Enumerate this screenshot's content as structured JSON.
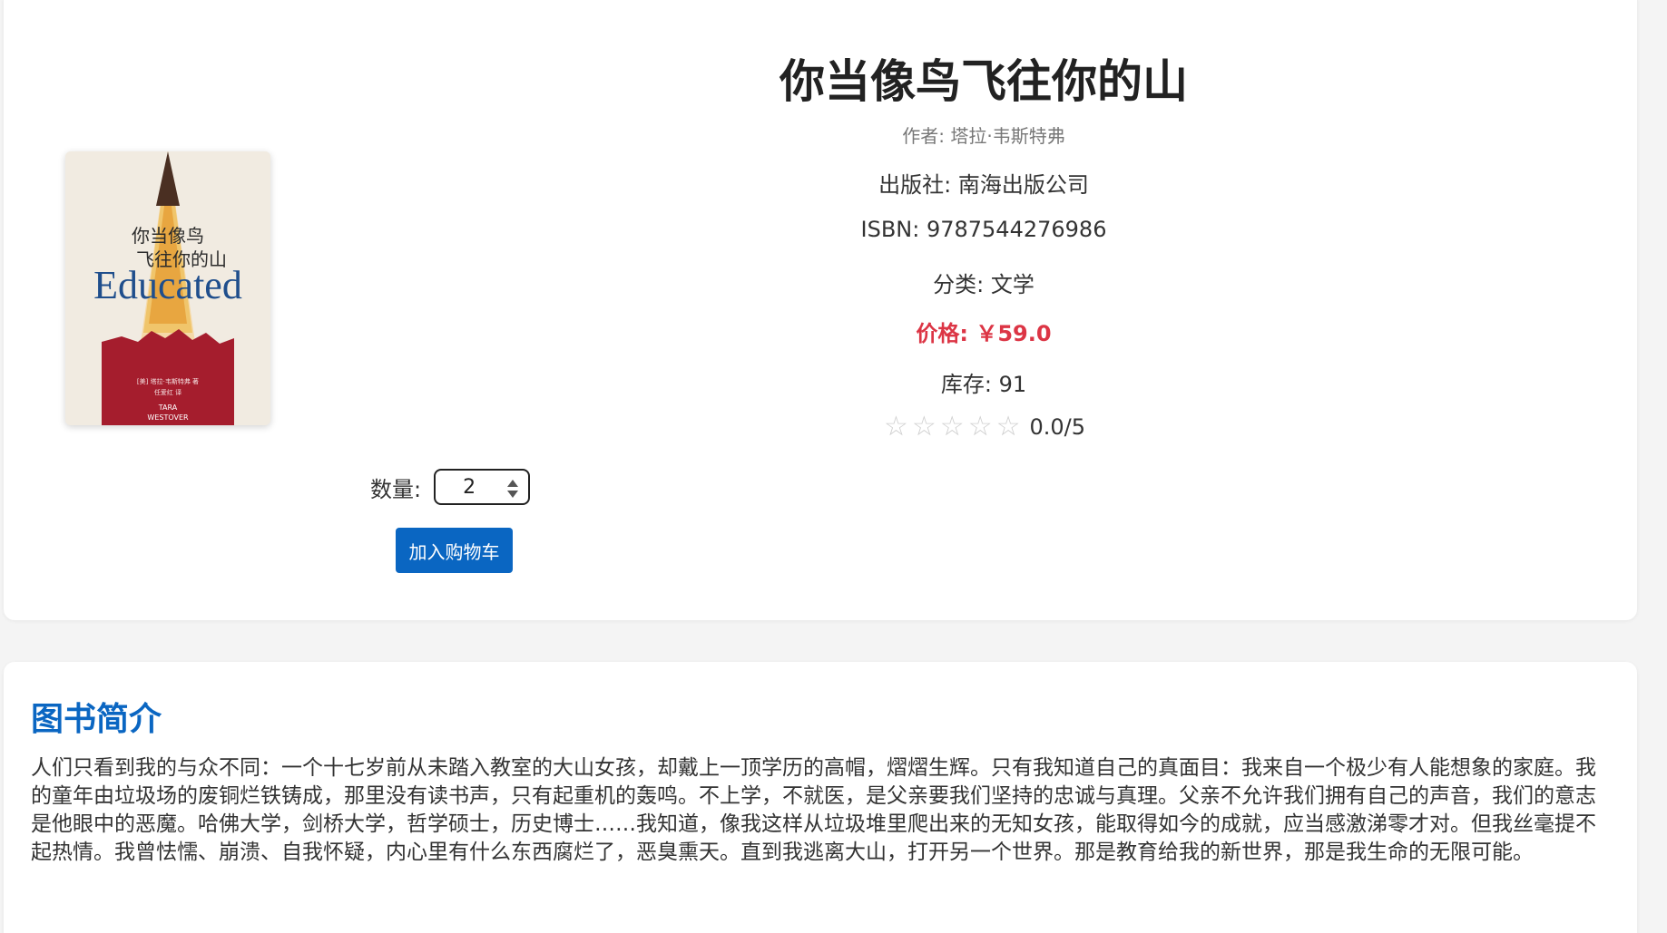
{
  "book": {
    "title": "你当像鸟飞往你的山",
    "author": "作者: 塔拉·韦斯特弗",
    "publisher": "出版社: 南海出版公司",
    "isbn": "ISBN: 9787544276986",
    "category": "分类: 文学",
    "price": "价格: ￥59.0",
    "stock": "库存: 91",
    "rating_text": "0.0/5",
    "rating_value": 0,
    "rating_max": 5,
    "star_glyph": "☆"
  },
  "cover": {
    "cn_line1": "你当像鸟",
    "cn_line2": "飞往你的山",
    "en_title": "Educated",
    "small_line1": "[美] 塔拉·韦斯特弗 著",
    "small_line2": "任爱红 译",
    "author_en1": "TARA",
    "author_en2": "WESTOVER"
  },
  "purchase": {
    "qty_label": "数量:",
    "qty_value": "2",
    "add_to_cart": "加入购物车"
  },
  "intro": {
    "heading": "图书简介",
    "text": "人们只看到我的与众不同：一个十七岁前从未踏入教室的大山女孩，却戴上一顶学历的高帽，熠熠生辉。只有我知道自己的真面目：我来自一个极少有人能想象的家庭。我的童年由垃圾场的废铜烂铁铸成，那里没有读书声，只有起重机的轰鸣。不上学，不就医，是父亲要我们坚持的忠诚与真理。父亲不允许我们拥有自己的声音，我们的意志是他眼中的恶魔。哈佛大学，剑桥大学，哲学硕士，历史博士……我知道，像我这样从垃圾堆里爬出来的无知女孩，能取得如今的成就，应当感激涕零才对。但我丝毫提不起热情。我曾怯懦、崩溃、自我怀疑，内心里有什么东西腐烂了，恶臭熏天。直到我逃离大山，打开另一个世界。那是教育给我的新世界，那是我生命的无限可能。"
  },
  "colors": {
    "accent": "#0a66c2",
    "price": "#dc3545",
    "star_empty": "#cfcfcf"
  }
}
